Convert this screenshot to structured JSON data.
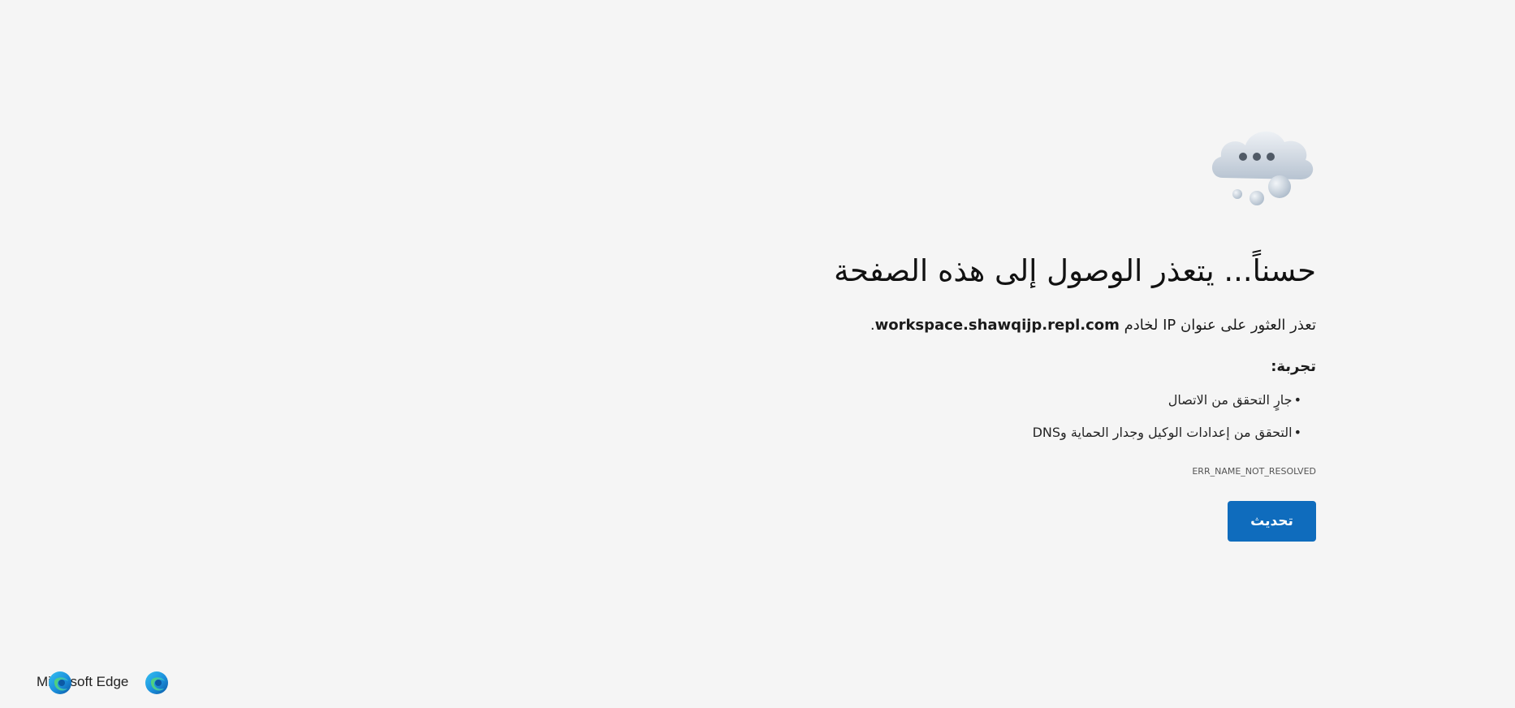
{
  "error_page": {
    "icon": "cloud-with-dots-icon",
    "title": "حسناً... يتعذر الوصول إلى هذه الصفحة",
    "description_prefix": "تعذر العثور على عنوان IP لخادم ",
    "host": "workspace.shawqijp.repl.com",
    "description_suffix": ".",
    "try_label": "تجربة:",
    "suggestions": [
      {
        "bullet": "•",
        "text": "جارٍ التحقق من الاتصال"
      },
      {
        "bullet": "•",
        "text": "التحقق من إعدادات الوكيل وجدار الحماية وDNS"
      }
    ],
    "error_code": "ERR_NAME_NOT_RESOLVED",
    "refresh_label": "تحديث"
  },
  "footer": {
    "brand": "Microsoft Edge",
    "logo_icon": "edge-logo-icon"
  },
  "colors": {
    "background": "#f5f5f5",
    "button": "#0f6cbd",
    "button_text": "#ffffff"
  }
}
